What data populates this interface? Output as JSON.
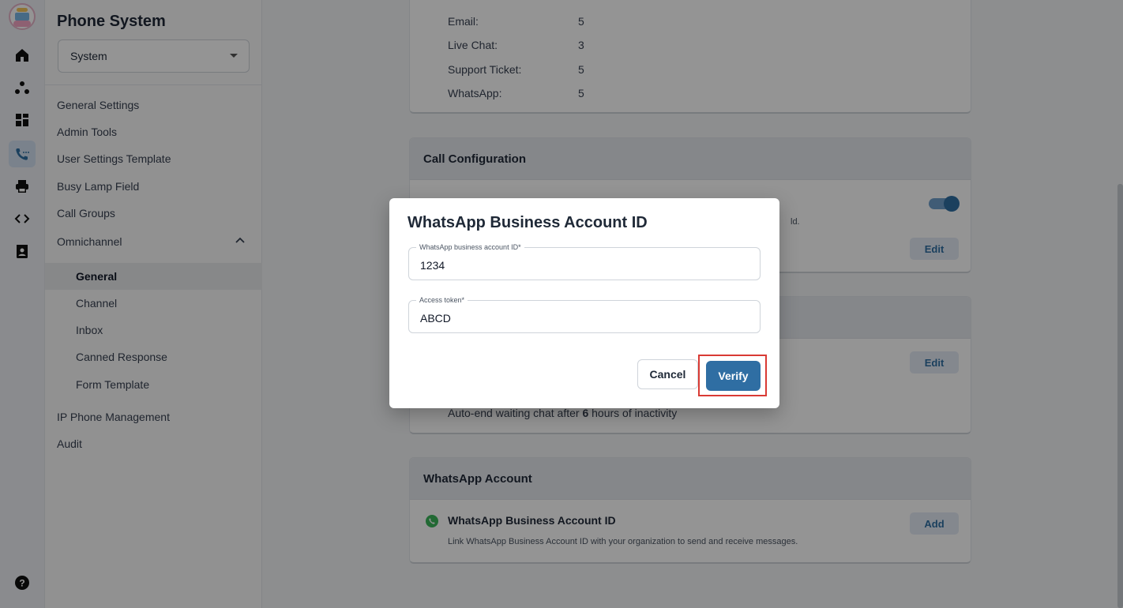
{
  "rail": {
    "icons": [
      "app-logo",
      "home-icon",
      "org-chart-icon",
      "dashboard-icon",
      "phone-system-icon",
      "printer-icon",
      "code-icon",
      "contacts-icon",
      "help-icon"
    ]
  },
  "nav": {
    "title": "Phone System",
    "select_value": "System",
    "items": {
      "general_settings": "General Settings",
      "admin_tools": "Admin Tools",
      "user_settings_template": "User Settings Template",
      "busy_lamp_field": "Busy Lamp Field",
      "call_groups": "Call Groups",
      "omnichannel": "Omnichannel",
      "ip_phone_management": "IP Phone Management",
      "audit": "Audit"
    },
    "omnichannel_sub": {
      "general": "General",
      "channel": "Channel",
      "inbox": "Inbox",
      "canned_response": "Canned Response",
      "form_template": "Form Template"
    }
  },
  "main": {
    "limits": [
      {
        "label": "Email:",
        "value": "5"
      },
      {
        "label": "Live Chat:",
        "value": "3"
      },
      {
        "label": "Support Ticket:",
        "value": "5"
      },
      {
        "label": "WhatsApp:",
        "value": "5"
      }
    ],
    "call_config": {
      "header": "Call Configuration",
      "edit_label": "Edit",
      "partial_desc": "ld."
    },
    "chat_card": {
      "edit_label": "Edit",
      "auto_end_prefix": "Auto-end waiting chat after ",
      "auto_end_hours": "6",
      "auto_end_suffix": " hours of inactivity"
    },
    "whatsapp_card": {
      "header": "WhatsApp Account",
      "item_title": "WhatsApp Business Account ID",
      "item_desc": "Link WhatsApp Business Account ID with your organization to send and receive messages.",
      "add_label": "Add"
    }
  },
  "dialog": {
    "title": "WhatsApp Business Account ID",
    "account_id_label": "WhatsApp business account ID*",
    "account_id_value": "1234",
    "token_label": "Access token*",
    "token_value": "ABCD",
    "cancel_label": "Cancel",
    "verify_label": "Verify"
  },
  "colors": {
    "accent": "#2f6ea3",
    "highlight_border": "#d93a34"
  }
}
